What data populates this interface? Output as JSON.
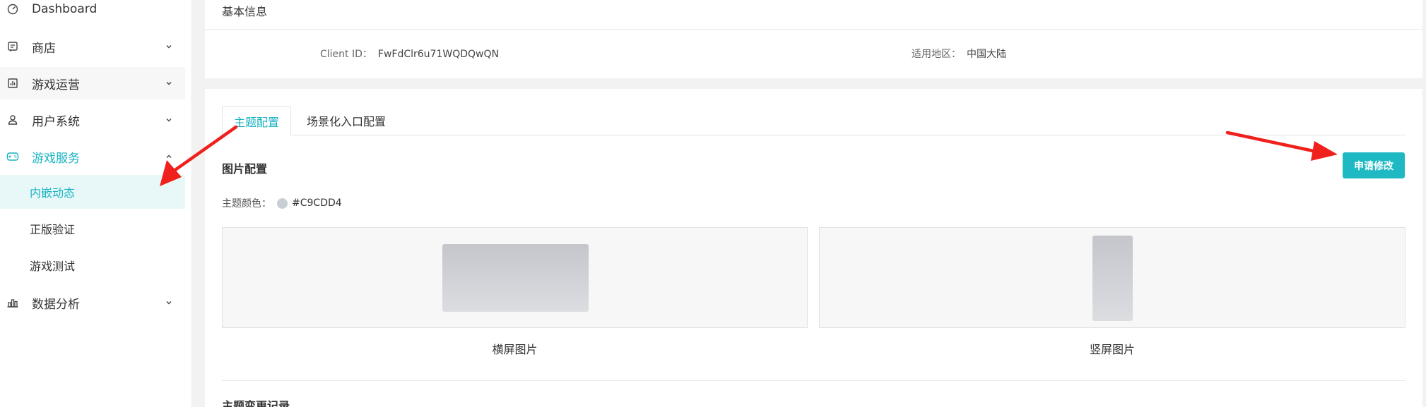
{
  "sidebar": {
    "items": [
      {
        "label": "Dashboard",
        "icon": "gauge-icon"
      },
      {
        "label": "商店",
        "icon": "store-icon"
      },
      {
        "label": "游戏运营",
        "icon": "chart-icon"
      },
      {
        "label": "用户系统",
        "icon": "user-icon"
      },
      {
        "label": "游戏服务",
        "icon": "gamepad-icon"
      },
      {
        "label": "数据分析",
        "icon": "analytics-icon"
      }
    ],
    "subitems": [
      {
        "label": "内嵌动态"
      },
      {
        "label": "正版验证"
      },
      {
        "label": "游戏测试"
      }
    ]
  },
  "basic_info": {
    "title": "基本信息",
    "client_id_label": "Client ID：",
    "client_id_value": "FwFdClr6u71WQDQwQN",
    "region_label": "适用地区：",
    "region_value": "中国大陆"
  },
  "tabs": [
    {
      "label": "主题配置",
      "active": true
    },
    {
      "label": "场景化入口配置",
      "active": false
    }
  ],
  "image_config": {
    "title": "图片配置",
    "apply_button": "申请修改",
    "theme_color_label": "主题颜色：",
    "theme_color_value": "#C9CDD4",
    "landscape_caption": "横屏图片",
    "portrait_caption": "竖屏图片"
  },
  "record_title": "主题变更记录",
  "colors": {
    "accent": "#17b3c1",
    "button": "#1fb9c4",
    "theme_swatch": "#C9CDD4",
    "arrow": "#f0201c"
  }
}
